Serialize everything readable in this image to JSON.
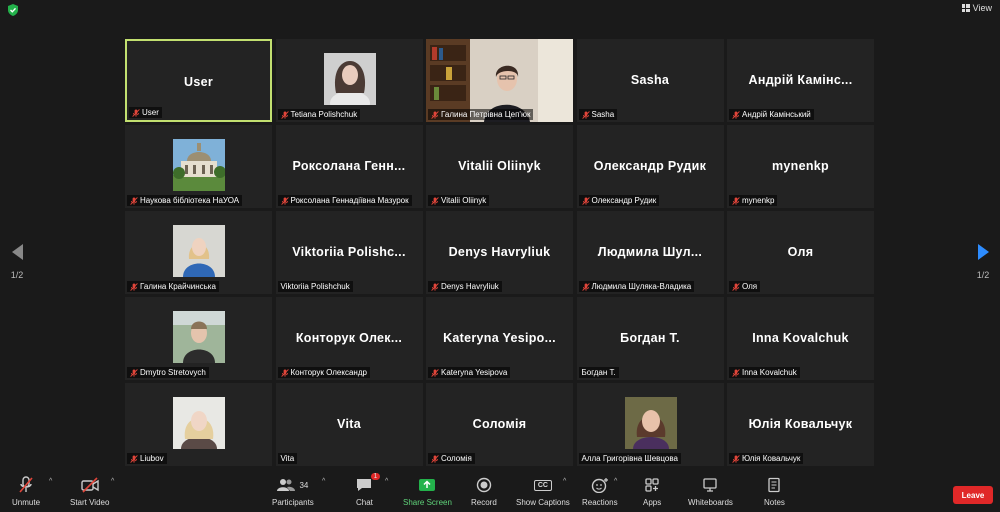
{
  "top": {
    "view_label": "View"
  },
  "pager": {
    "left": "1/2",
    "right": "1/2"
  },
  "tiles": [
    {
      "name": "User",
      "label": "User",
      "muted": true,
      "kind": "name",
      "active": true
    },
    {
      "name": "",
      "label": "Tetiana Polishchuk",
      "muted": true,
      "kind": "photo",
      "photo": "woman-dark-hair"
    },
    {
      "name": "",
      "label": "Галина Петрівна Цеп'юк",
      "muted": true,
      "kind": "video"
    },
    {
      "name": "Sasha",
      "label": "Sasha",
      "muted": true,
      "kind": "name"
    },
    {
      "name": "Андрій Камінс...",
      "label": "Андрій Камінський",
      "muted": true,
      "kind": "name"
    },
    {
      "name": "",
      "label": "Наукова бібліотека НаУОА",
      "muted": true,
      "kind": "photo",
      "photo": "building"
    },
    {
      "name": "Роксолана Генн...",
      "label": "Роксолана Геннадіївна Мазурок",
      "muted": true,
      "kind": "name"
    },
    {
      "name": "Vitalii Oliinyk",
      "label": "Vitalii Oliinyk",
      "muted": true,
      "kind": "name"
    },
    {
      "name": "Олександр Рудик",
      "label": "Олександр Рудик",
      "muted": true,
      "kind": "name"
    },
    {
      "name": "mynenkp",
      "label": "mynenkp",
      "muted": true,
      "kind": "name"
    },
    {
      "name": "",
      "label": "Галина Крайчинська",
      "muted": true,
      "kind": "photo",
      "photo": "woman-blue"
    },
    {
      "name": "Viktoriia  Polishc...",
      "label": "Viktoriia Polishchuk",
      "muted": false,
      "kind": "name"
    },
    {
      "name": "Denys Havryliuk",
      "label": "Denys Havryliuk",
      "muted": true,
      "kind": "name"
    },
    {
      "name": "Людмила  Шул...",
      "label": "Людмила Шуляка-Владика",
      "muted": true,
      "kind": "name"
    },
    {
      "name": "Оля",
      "label": "Оля",
      "muted": true,
      "kind": "name"
    },
    {
      "name": "",
      "label": "Dmytro Stretovych",
      "muted": true,
      "kind": "photo",
      "photo": "man-outdoor"
    },
    {
      "name": "Конторук  Олек...",
      "label": "Конторук Олександр",
      "muted": true,
      "kind": "name"
    },
    {
      "name": "Kateryna  Yesipo...",
      "label": "Kateryna Yesipova",
      "muted": true,
      "kind": "name"
    },
    {
      "name": "Богдан Т.",
      "label": "Богдан Т.",
      "muted": false,
      "kind": "name"
    },
    {
      "name": "Inna Kovalchuk",
      "label": "Inna Kovalchuk",
      "muted": true,
      "kind": "name"
    },
    {
      "name": "",
      "label": "Liubov",
      "muted": true,
      "kind": "photo",
      "photo": "woman-blonde"
    },
    {
      "name": "Vita",
      "label": "Vita",
      "muted": false,
      "kind": "name"
    },
    {
      "name": "Соломія",
      "label": "Соломія",
      "muted": true,
      "kind": "name"
    },
    {
      "name": "",
      "label": "Алла Григорівна Шевцова",
      "muted": false,
      "kind": "photo",
      "photo": "woman-portrait"
    },
    {
      "name": "Юлія Ковальчук",
      "label": "Юлія Ковальчук",
      "muted": true,
      "kind": "name"
    }
  ],
  "toolbar": {
    "unmute": "Unmute",
    "start_video": "Start Video",
    "participants": "Participants",
    "participants_count": "34",
    "chat": "Chat",
    "chat_badge": "1",
    "share_screen": "Share Screen",
    "record": "Record",
    "show_captions": "Show Captions",
    "cc": "CC",
    "reactions": "Reactions",
    "apps": "Apps",
    "whiteboards": "Whiteboards",
    "notes": "Notes",
    "leave": "Leave"
  },
  "colors": {
    "active_border": "#c2e070",
    "share_green": "#23b24b",
    "leave_red": "#e02828",
    "mute_red": "#e0453a",
    "next_arrow": "#2d8cff"
  }
}
